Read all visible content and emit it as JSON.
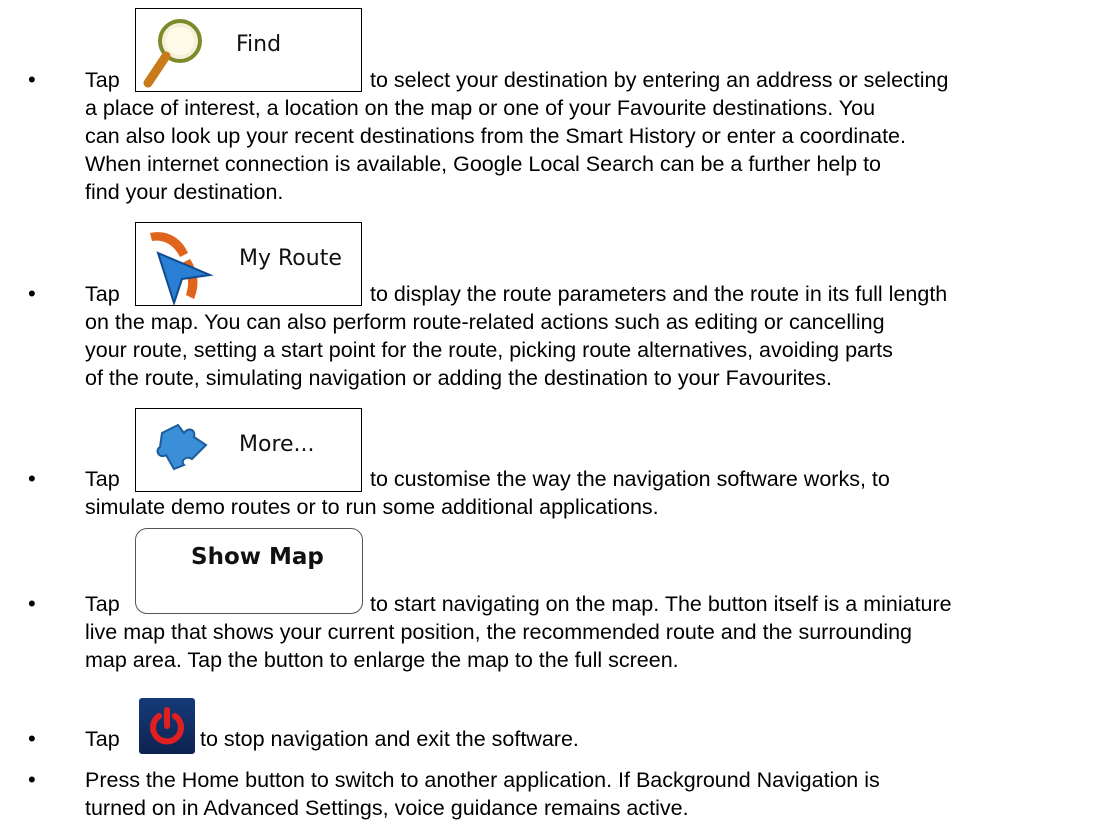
{
  "items": [
    {
      "tap": "Tap",
      "button_label": "Find",
      "icon": "magnifier-icon",
      "text_first": "to select your destination by entering an address or selecting",
      "lines": [
        "a place of interest, a location on the map or one of your Favourite destinations. You",
        "can also look up your recent destinations from the Smart History or enter a coordinate.",
        "When internet connection is available, Google Local Search can be a further help to",
        "find your destination."
      ]
    },
    {
      "tap": "Tap",
      "button_label": "My Route",
      "icon": "route-arrow-icon",
      "text_first": "to display the route parameters and the route in its full length",
      "lines": [
        "on the map. You can also perform route-related actions such as editing or cancelling",
        "your route, setting a start point for the route, picking route alternatives, avoiding parts",
        "of the route, simulating navigation or adding the destination to your Favourites."
      ]
    },
    {
      "tap": "Tap",
      "button_label": "More...",
      "icon": "puzzle-piece-icon",
      "text_first": "to customise the way the navigation software works, to",
      "lines": [
        "simulate demo routes or to run some additional applications."
      ]
    },
    {
      "tap": "Tap",
      "button_label": "Show Map",
      "text_first": "to start navigating on the map. The button itself is a miniature",
      "lines": [
        "live map that shows your current position, the recommended route and the surrounding",
        "map area. Tap the button to enlarge the map to the full screen."
      ]
    },
    {
      "tap": "Tap",
      "icon": "power-icon",
      "text_first": "to stop navigation and exit the software."
    },
    {
      "lines": [
        "Press the Home button to switch to another application. If Background Navigation is",
        "turned on in Advanced Settings, voice guidance remains active."
      ]
    }
  ],
  "colors": {
    "power_bg": "#163b78",
    "power_symbol": "#e02020",
    "route_orange": "#e0641e",
    "route_blue": "#2a7fd4"
  }
}
